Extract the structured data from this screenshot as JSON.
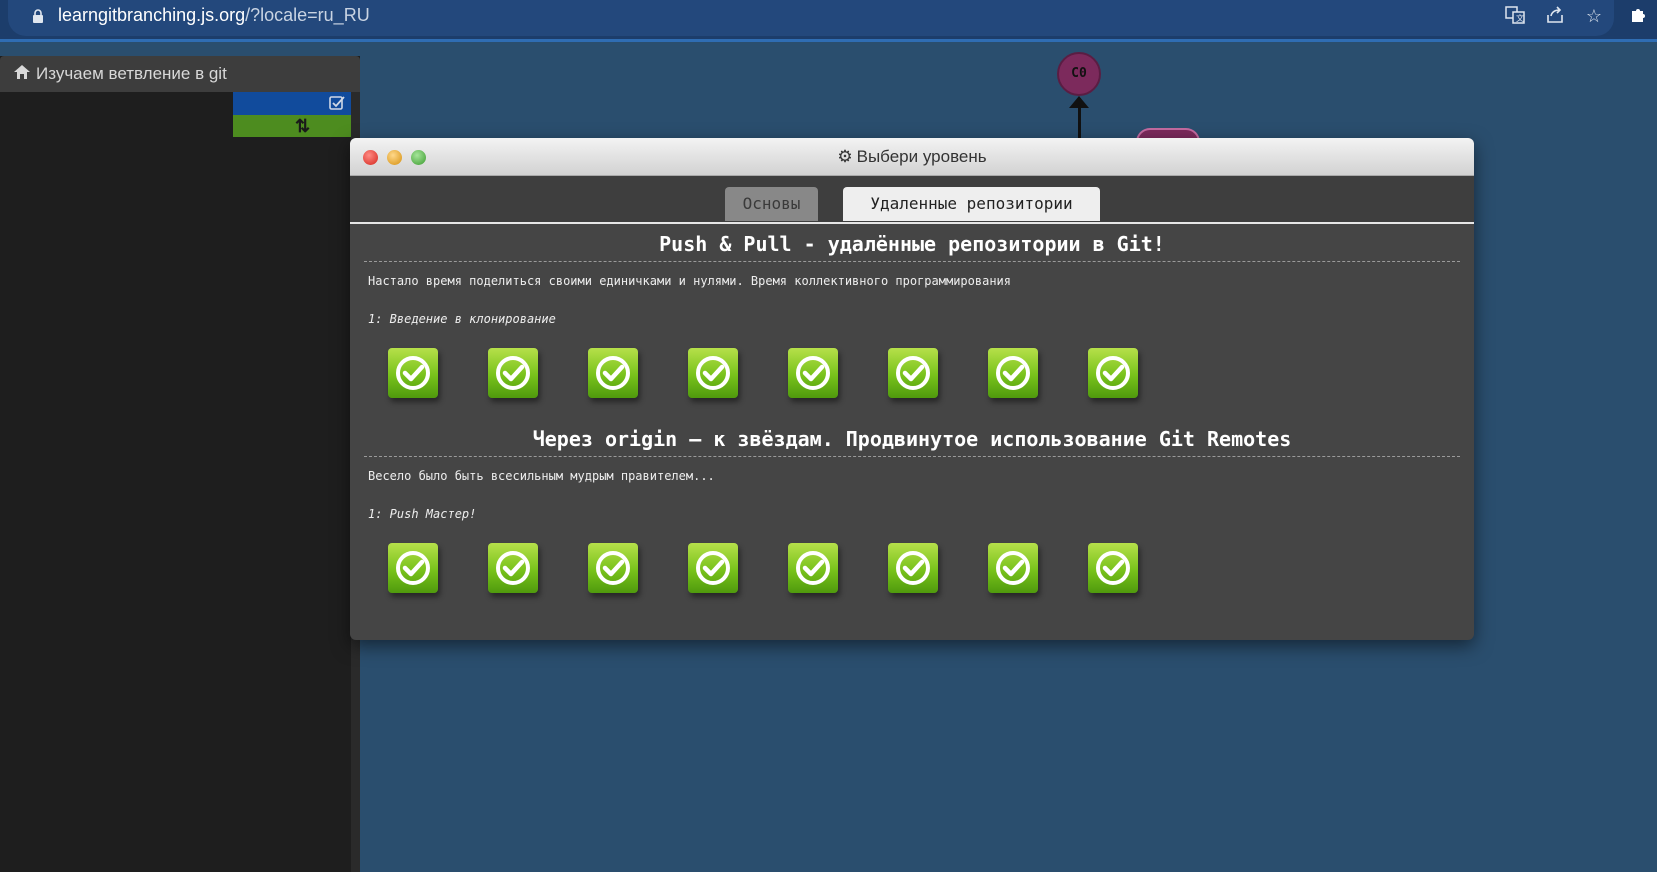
{
  "browser": {
    "url_host": "learngitbranching.js.org",
    "url_path": "/?locale=ru_RU",
    "icons": [
      "lock-icon",
      "translate-icon",
      "share-icon",
      "star-icon",
      "extensions-icon"
    ]
  },
  "sidebar": {
    "title": "Изучаем ветвление в git",
    "icons": [
      "home-icon",
      "checkbox-icon",
      "swap-icon"
    ]
  },
  "graph": {
    "commit_label": "C0"
  },
  "modal": {
    "title": "Выбери уровень",
    "tabs": [
      {
        "label": "Основы",
        "active": false
      },
      {
        "label": "Удаленные репозитории",
        "active": true
      }
    ],
    "sections": [
      {
        "title": "Push & Pull - удалённые репозитории в Git!",
        "description": "Настало время поделиться своими единичками и нулями. Время коллективного программирования",
        "level": "1: Введение в клонирование",
        "levels_completed": 8
      },
      {
        "title": "Через origin – к звёздам. Продвинутое использование Git Remotes",
        "description": "Весело было быть всесильным мудрым правителем...",
        "level": "1: Push Мастер!",
        "levels_completed": 8
      }
    ]
  },
  "colors": {
    "background": "#2a4e6e",
    "modal": "#454545",
    "level_button": "#78c21b",
    "commit": "#7c2a5c"
  }
}
